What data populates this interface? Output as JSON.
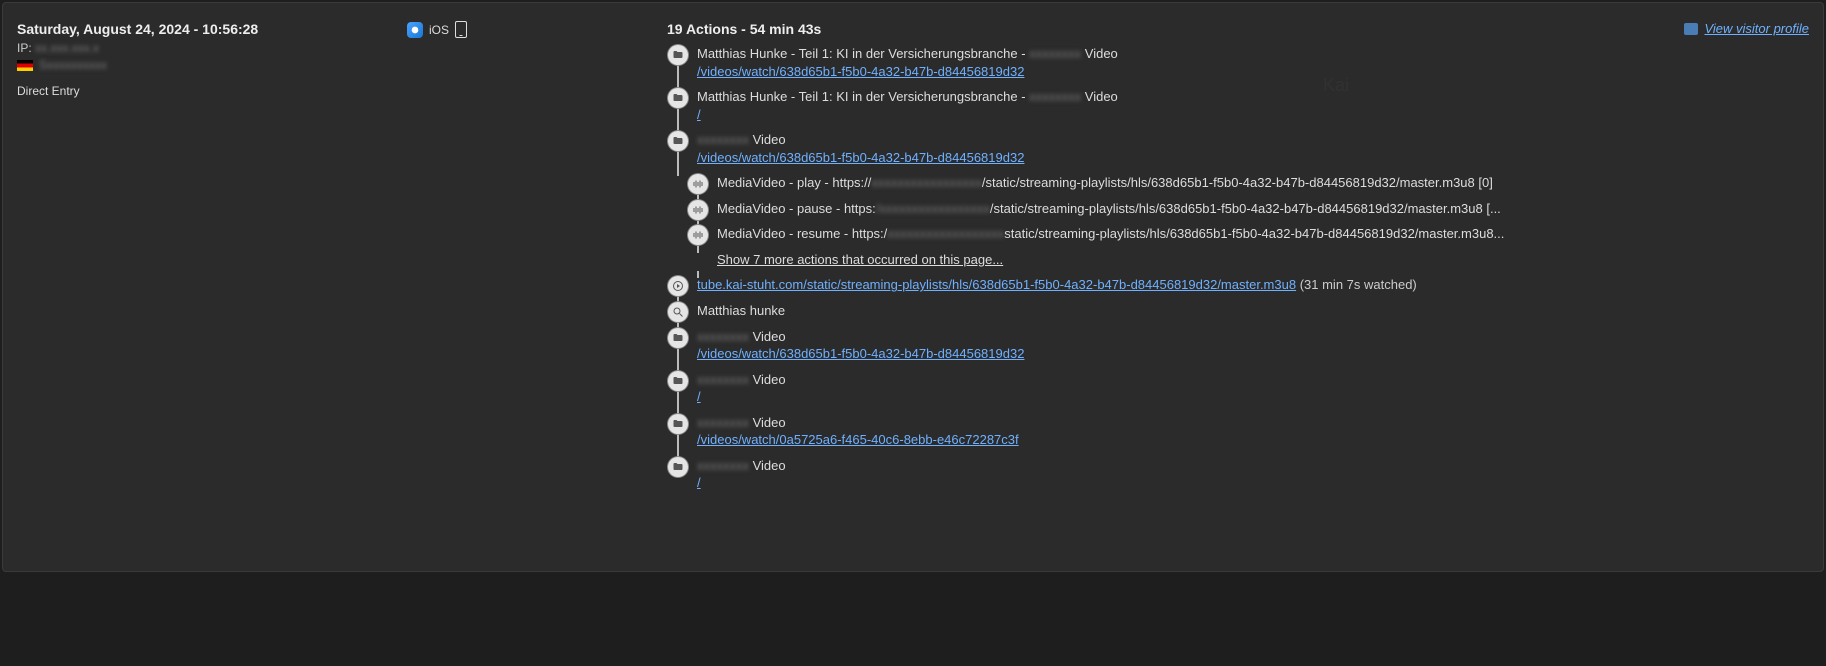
{
  "header": {
    "date": "Saturday, August 24, 2024 - 10:56:28",
    "ip_label": "IP:",
    "ip_redacted": "xx.xxx.xxx.x",
    "location_redacted": "Sxxxxxxxxxx",
    "direct_entry": "Direct Entry",
    "os_label": "iOS"
  },
  "actions_summary": "19 Actions - 54 min 43s",
  "view_profile": "View visitor profile",
  "watermark": "Kai",
  "timeline": [
    {
      "icon": "folder",
      "title_pre": "Matthias Hunke - Teil 1: KI in der Versicherungsbranche - ",
      "title_red": "xxxxxxxx",
      "title_post": " Video",
      "link": "/videos/watch/638d65b1-f5b0-4a32-b47b-d84456819d32",
      "indent": 0
    },
    {
      "icon": "folder",
      "title_pre": "Matthias Hunke - Teil 1: KI in der Versicherungsbranche - ",
      "title_red": "xxxxxxxx",
      "title_post": " Video",
      "link": "/",
      "indent": 0
    },
    {
      "icon": "folder",
      "title_pre": "",
      "title_red": "xxxxxxxx",
      "title_post": " Video",
      "link": "/videos/watch/638d65b1-f5b0-4a32-b47b-d84456819d32",
      "indent": 0
    },
    {
      "icon": "media",
      "title_pre": "MediaVideo - play - https://",
      "title_red": "xxxxxxxxxxxxxxxxx",
      "title_post": "/static/streaming-playlists/hls/638d65b1-f5b0-4a32-b47b-d84456819d32/master.m3u8 [0]",
      "indent": 1
    },
    {
      "icon": "media",
      "title_pre": "MediaVideo - pause - https:",
      "title_red": "/xxxxxxxxxxxxxxxxx",
      "title_post": "/static/streaming-playlists/hls/638d65b1-f5b0-4a32-b47b-d84456819d32/master.m3u8 [...",
      "indent": 1
    },
    {
      "icon": "media",
      "title_pre": "MediaVideo - resume - https:/",
      "title_red": "xxxxxxxxxxxxxxxxxx",
      "title_post": "static/streaming-playlists/hls/638d65b1-f5b0-4a32-b47b-d84456819d32/master.m3u8...",
      "indent": 1
    },
    {
      "icon": "none",
      "show_more": "Show 7 more actions that occurred on this page...",
      "indent": 1
    },
    {
      "icon": "play",
      "link": "tube.kai-stuht.com/static/streaming-playlists/hls/638d65b1-f5b0-4a32-b47b-d84456819d32/master.m3u8",
      "suffix": " (31 min 7s watched)",
      "indent": 0
    },
    {
      "icon": "search",
      "title_pre": "Matthias hunke",
      "indent": 0
    },
    {
      "icon": "folder",
      "title_pre": "",
      "title_red": "xxxxxxxx",
      "title_post": " Video",
      "link": "/videos/watch/638d65b1-f5b0-4a32-b47b-d84456819d32",
      "indent": 0
    },
    {
      "icon": "folder",
      "title_pre": "",
      "title_red": "xxxxxxxx",
      "title_post": " Video",
      "link": "/",
      "indent": 0
    },
    {
      "icon": "folder",
      "title_pre": "",
      "title_red": "xxxxxxxx",
      "title_post": " Video",
      "link": "/videos/watch/0a5725a6-f465-40c6-8ebb-e46c72287c3f",
      "indent": 0
    },
    {
      "icon": "folder",
      "title_pre": "",
      "title_red": "xxxxxxxx",
      "title_post": " Video",
      "link": "/",
      "indent": 0
    }
  ]
}
